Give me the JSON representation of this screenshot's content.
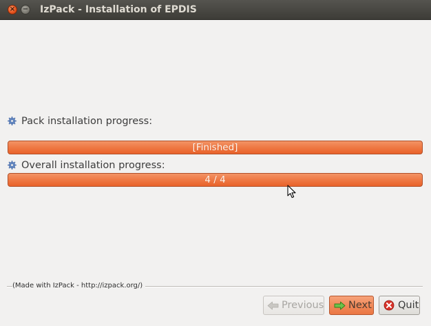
{
  "window": {
    "title": "IzPack - Installation of EPDIS",
    "close_glyph": "×",
    "minimize_glyph": "−"
  },
  "pack_progress": {
    "label": "Pack installation progress:",
    "bar_text": "[Finished]",
    "fraction": 1.0,
    "icon": "gear-icon"
  },
  "overall_progress": {
    "label": "Overall installation progress:",
    "bar_text": "4 / 4",
    "fraction": 1.0,
    "icon": "gear-icon"
  },
  "footer": {
    "note": "(Made with IzPack - http://izpack.org/)"
  },
  "buttons": {
    "previous": {
      "label": "Previous",
      "icon": "arrow-left-icon",
      "enabled": false
    },
    "next": {
      "label": "Next",
      "icon": "arrow-right-icon",
      "enabled": true
    },
    "quit": {
      "label": "Quit",
      "icon": "quit-icon",
      "enabled": true
    }
  },
  "colors": {
    "accent": "#ef7b47",
    "titlebar": "#3d3c37",
    "background": "#f2f1f0"
  }
}
